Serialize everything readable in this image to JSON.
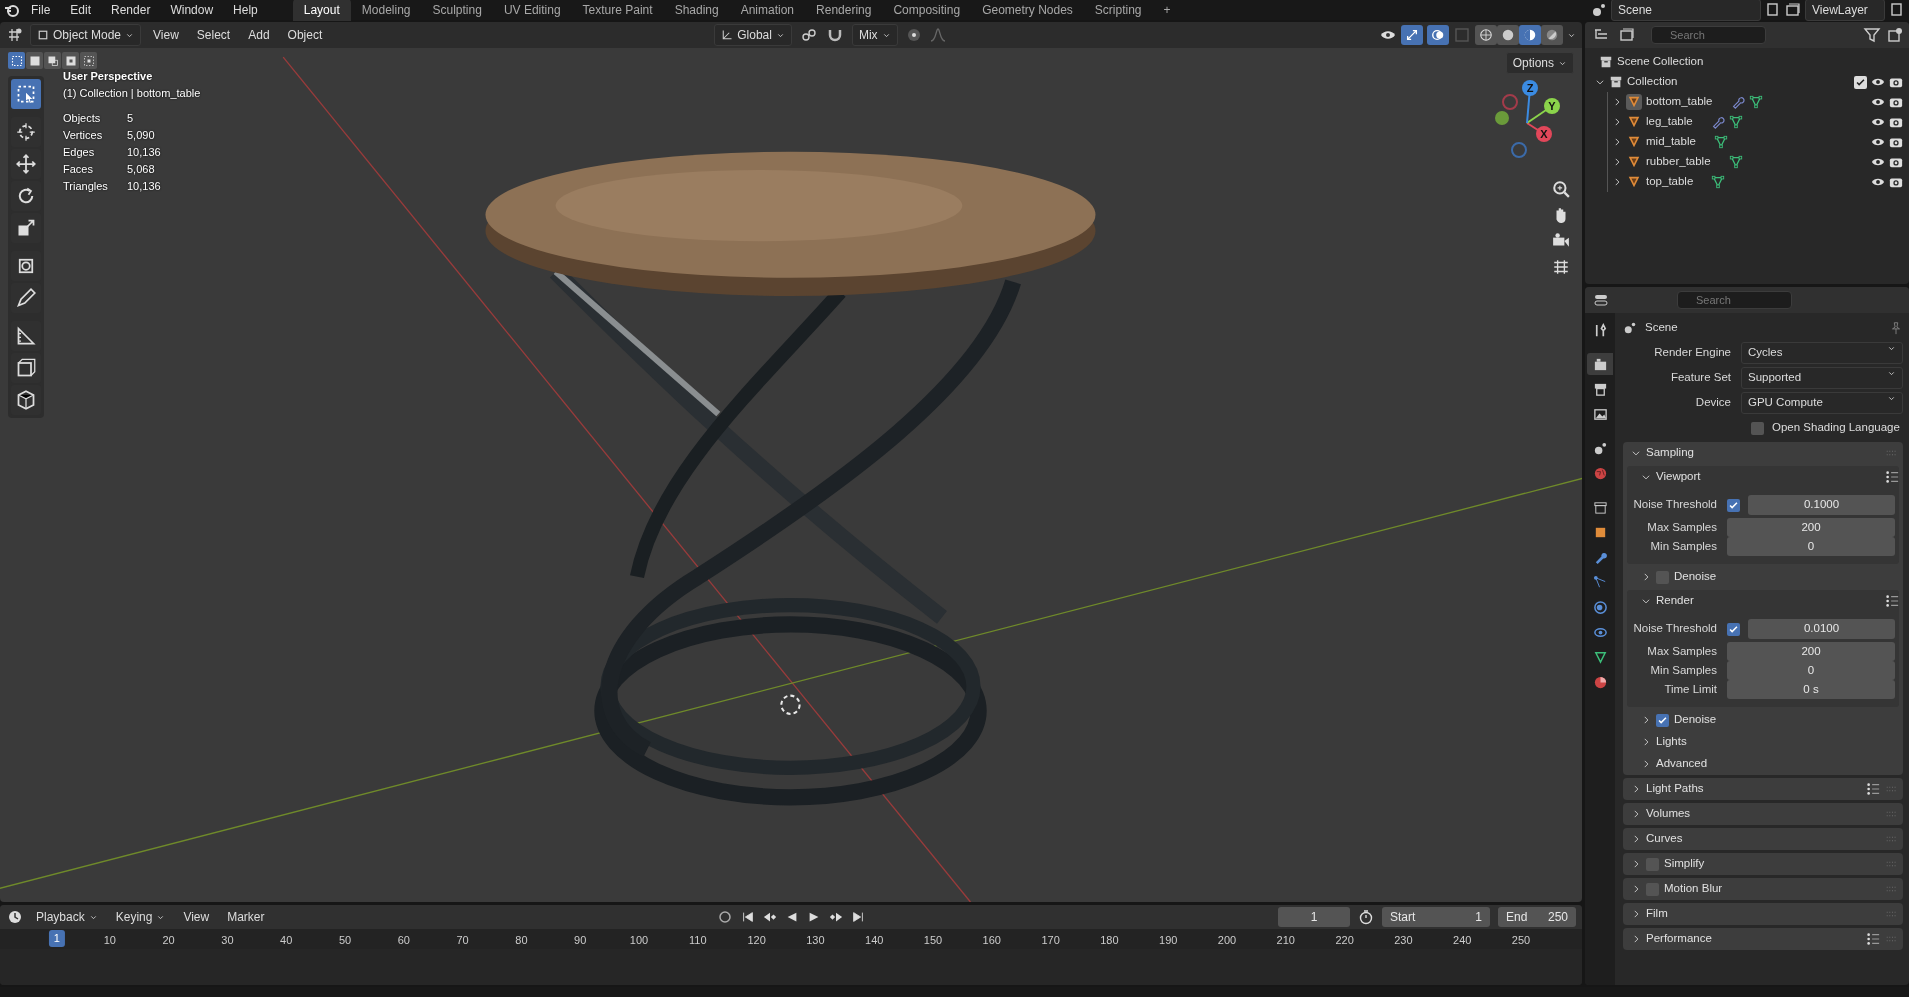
{
  "menu": [
    "File",
    "Edit",
    "Render",
    "Window",
    "Help"
  ],
  "workspaces": [
    {
      "label": "Layout",
      "selected": true
    },
    {
      "label": "Modeling",
      "selected": false
    },
    {
      "label": "Sculpting",
      "selected": false
    },
    {
      "label": "UV Editing",
      "selected": false
    },
    {
      "label": "Texture Paint",
      "selected": false
    },
    {
      "label": "Shading",
      "selected": false
    },
    {
      "label": "Animation",
      "selected": false
    },
    {
      "label": "Rendering",
      "selected": false
    },
    {
      "label": "Compositing",
      "selected": false
    },
    {
      "label": "Geometry Nodes",
      "selected": false
    },
    {
      "label": "Scripting",
      "selected": false
    }
  ],
  "add_workspace": "+",
  "scene": "Scene",
  "view_layer": "ViewLayer",
  "viewport_header": {
    "mode": "Object Mode",
    "menus": [
      "View",
      "Select",
      "Add",
      "Object"
    ],
    "orientation": "Global",
    "snap_mode": "Mix",
    "options": "Options"
  },
  "select_modes": [
    {
      "selected": true
    },
    {
      "selected": false
    },
    {
      "selected": false
    },
    {
      "selected": false
    },
    {
      "selected": false
    }
  ],
  "tools": [
    {
      "selected": true
    },
    {
      "selected": false
    },
    {
      "selected": false
    },
    {
      "selected": false
    },
    {
      "selected": false
    },
    {
      "selected": false
    },
    {
      "selected": false
    },
    {
      "selected": false
    },
    {
      "selected": false
    },
    {
      "selected": false
    }
  ],
  "shading_modes": [
    {
      "selected": false
    },
    {
      "selected": false
    },
    {
      "selected": true
    },
    {
      "selected": false
    }
  ],
  "overlay": {
    "view_name": "User Perspective",
    "context": "(1) Collection | bottom_table",
    "stats": [
      {
        "label": "Objects",
        "value": "5"
      },
      {
        "label": "Vertices",
        "value": "5,090"
      },
      {
        "label": "Edges",
        "value": "10,136"
      },
      {
        "label": "Faces",
        "value": "5,068"
      },
      {
        "label": "Triangles",
        "value": "10,136"
      }
    ]
  },
  "gizmo_axes": [
    "X",
    "Y",
    "Z"
  ],
  "outliner": {
    "search_placeholder": "Search",
    "root": "Scene Collection",
    "collection": {
      "name": "Collection",
      "expanded": true,
      "checked": true,
      "children": [
        {
          "name": "bottom_table",
          "active": true,
          "modifier": true
        },
        {
          "name": "leg_table",
          "active": false,
          "modifier": true
        },
        {
          "name": "mid_table",
          "active": false,
          "modifier": false
        },
        {
          "name": "rubber_table",
          "active": false,
          "modifier": false
        },
        {
          "name": "top_table",
          "active": false,
          "modifier": false
        }
      ]
    }
  },
  "properties": {
    "search_placeholder": "Search",
    "context": "Scene",
    "tabs": [
      {
        "selected": false
      },
      {
        "selected": true
      },
      {
        "selected": false
      },
      {
        "selected": false
      },
      {
        "selected": false
      },
      {
        "selected": false
      },
      {
        "selected": false
      },
      {
        "selected": false
      },
      {
        "selected": false
      },
      {
        "selected": false
      },
      {
        "selected": false
      },
      {
        "selected": false
      },
      {
        "selected": false
      },
      {
        "selected": false
      }
    ],
    "fields": [
      {
        "label": "Render Engine",
        "value": "Cycles"
      },
      {
        "label": "Feature Set",
        "value": "Supported"
      },
      {
        "label": "Device",
        "value": "GPU Compute"
      }
    ],
    "osl": {
      "label": "Open Shading Language",
      "checked": false
    },
    "sampling": {
      "label": "Sampling",
      "expanded": true,
      "subpanels": [
        {
          "kind": "rows",
          "label": "Viewport",
          "expanded": true,
          "presets": true,
          "rows": [
            {
              "kind": "toggle",
              "label": "Noise Threshold",
              "checked": true,
              "value": "0.1000"
            },
            {
              "kind": "number",
              "label": "Max Samples",
              "value": "200"
            },
            {
              "kind": "number",
              "label": "Min Samples",
              "value": "0"
            }
          ]
        },
        {
          "kind": "check",
          "label": "Denoise",
          "expanded": false,
          "checked": false
        },
        {
          "kind": "rows",
          "label": "Render",
          "expanded": true,
          "presets": true,
          "rows": [
            {
              "kind": "toggle",
              "label": "Noise Threshold",
              "checked": true,
              "value": "0.0100"
            },
            {
              "kind": "number",
              "label": "Max Samples",
              "value": "200"
            },
            {
              "kind": "number",
              "label": "Min Samples",
              "value": "0"
            },
            {
              "kind": "number",
              "label": "Time Limit",
              "value": "0 s"
            }
          ]
        },
        {
          "kind": "check",
          "label": "Denoise",
          "expanded": false,
          "checked": true
        },
        {
          "kind": "plain",
          "label": "Lights",
          "expanded": false
        },
        {
          "kind": "plain",
          "label": "Advanced",
          "expanded": false
        }
      ]
    },
    "panels": [
      {
        "label": "Light Paths",
        "expanded": false,
        "presets": true
      },
      {
        "label": "Volumes",
        "expanded": false,
        "presets": false
      },
      {
        "label": "Curves",
        "expanded": false,
        "presets": false
      },
      {
        "label": "Simplify",
        "expanded": false,
        "presets": false,
        "checked": false
      },
      {
        "label": "Motion Blur",
        "expanded": false,
        "presets": false,
        "checked": false
      },
      {
        "label": "Film",
        "expanded": false,
        "presets": false
      },
      {
        "label": "Performance",
        "expanded": false,
        "presets": true
      }
    ]
  },
  "timeline": {
    "menus": [
      "Playback",
      "Keying",
      "View",
      "Marker"
    ],
    "current_frame": "1",
    "start_label": "Start",
    "start": "1",
    "end_label": "End",
    "end": "250",
    "playhead": "1",
    "ticks": [
      "10",
      "20",
      "30",
      "40",
      "50",
      "60",
      "70",
      "80",
      "90",
      "100",
      "110",
      "120",
      "130",
      "140",
      "150",
      "160",
      "170",
      "180",
      "190",
      "200",
      "210",
      "220",
      "230",
      "240",
      "250"
    ]
  }
}
